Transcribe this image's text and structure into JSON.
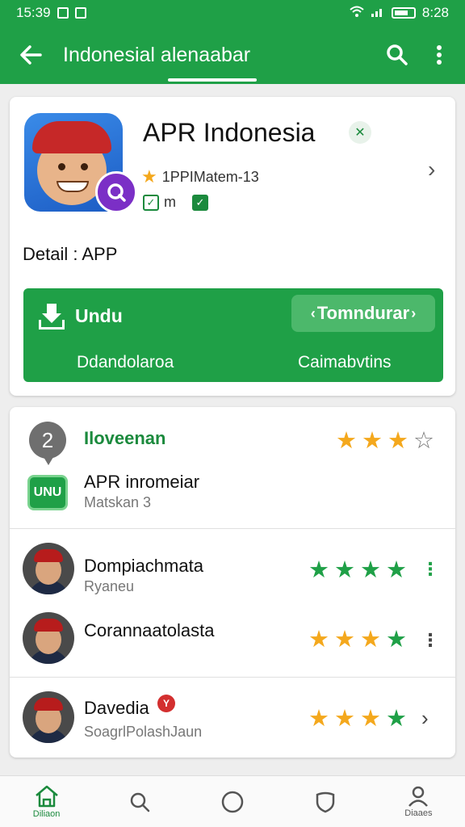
{
  "status_bar": {
    "time_left": "15:39",
    "time_right": "8:28"
  },
  "app_bar": {
    "title": "Indonesial alenaabar",
    "back_icon": "arrow-left-icon",
    "search_icon": "search-icon",
    "more_icon": "more-vert-icon"
  },
  "app": {
    "name": "APR Indonesia",
    "rating_text": "1PPIMatem-13",
    "tag_text": "m",
    "detail_label": "Detail : APP"
  },
  "download": {
    "button_label": "Undu",
    "secondary_button_label": "Tomndurar",
    "sub_left": "Ddandolaroa",
    "sub_right": "Caimabvtins"
  },
  "reviews": {
    "header_icon_text": "2",
    "header_title": "Iloveenan",
    "header_rating": 3,
    "source_badge": "UNU",
    "source_title": "APR inromeiar",
    "source_sub": "Matskan 3",
    "users": [
      {
        "name": "Dompiachmata",
        "sub": "Ryaneu",
        "rating": 4
      },
      {
        "name": "Corannaatolasta",
        "sub": "",
        "rating": 4
      },
      {
        "name": "Davedia",
        "sub": "SoagrlPolashJaun",
        "rating": 4
      }
    ]
  },
  "bottom_nav": {
    "home_label": "Diliaon",
    "profile_label": "Diaaes"
  },
  "colors": {
    "primary": "#1fa047",
    "star": "#f4a81d",
    "badge_purple": "#7b2fc6"
  }
}
